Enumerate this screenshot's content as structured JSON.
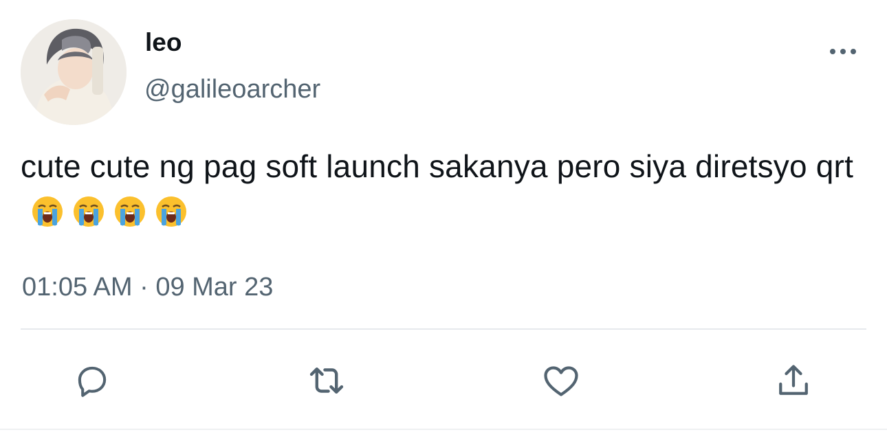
{
  "user": {
    "display_name": "leo",
    "handle": "@galileoarcher"
  },
  "tweet": {
    "text": "cute cute ng pag soft launch sakanya pero siya diretsyo qrt",
    "emojis": [
      "loudly-crying-face",
      "loudly-crying-face",
      "loudly-crying-face",
      "loudly-crying-face"
    ],
    "timestamp": "01:05 AM · 09 Mar 23"
  },
  "actions": {
    "reply": "reply-icon",
    "retweet": "retweet-icon",
    "like": "heart-icon",
    "share": "share-icon"
  },
  "colors": {
    "text": "#0f1419",
    "secondary": "#536471",
    "divider": "#e6e9ec",
    "emoji_face": "#fbc02d",
    "emoji_tear": "#4aa3df"
  }
}
